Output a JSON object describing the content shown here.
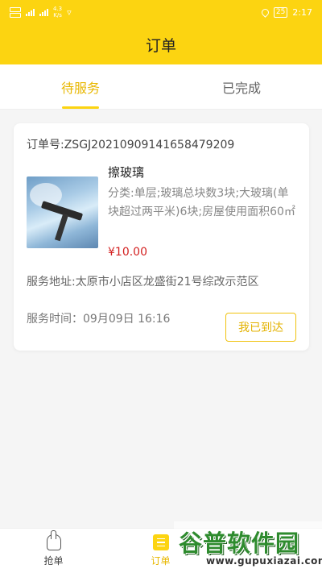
{
  "status_bar": {
    "sim1": "HD",
    "sim2": "HD",
    "network": "4G",
    "speed_value": "4.3",
    "speed_unit": "K/s",
    "battery": "25",
    "time": "2:17"
  },
  "header": {
    "title": "订单"
  },
  "tabs": [
    {
      "label": "待服务",
      "active": true
    },
    {
      "label": "已完成",
      "active": false
    }
  ],
  "order": {
    "order_no": "订单号:ZSGJ20210909141658479209",
    "service_name": "擦玻璃",
    "description": "分类:单层;玻璃总块数3块;大玻璃(单块超过两平米)6块;房屋使用面积60㎡",
    "price": "¥10.00",
    "address": "服务地址:太原市小店区龙盛街21号综改示范区",
    "service_time": "服务时间：09月09日 16:16",
    "action_label": "我已到达"
  },
  "bottom_nav": [
    {
      "label": "抢单",
      "icon": "hand-tap-icon",
      "active": false
    },
    {
      "label": "订单",
      "icon": "order-list-icon",
      "active": true
    }
  ],
  "watermark": {
    "logo": "谷普软件园",
    "url": "www.gupuxiazai.com"
  },
  "colors": {
    "brand_yellow": "#fcd411",
    "active_tab": "#e8b700",
    "price_red": "#d32121"
  }
}
